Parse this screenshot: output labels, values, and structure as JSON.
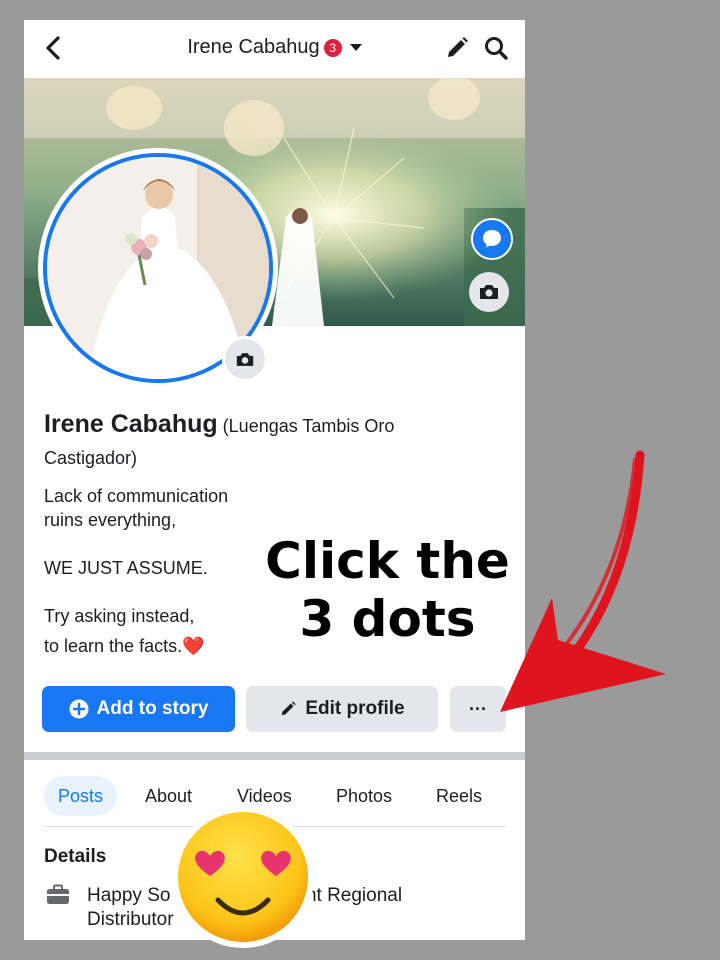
{
  "header": {
    "title": "Irene Cabahug",
    "notification_count": "3",
    "icons": [
      "back-arrow-icon",
      "chevron-down-icon",
      "pencil-icon",
      "search-icon"
    ]
  },
  "profile": {
    "name": "Irene Cabahug",
    "alt_name_line1": "(Luengas Tambis Oro",
    "alt_name_line2": "Castigador)",
    "bio": {
      "line1": "Lack of communication",
      "line2": "ruins everything,",
      "line3": "WE JUST ASSUME.",
      "line4": "Try asking instead,",
      "line5": "to learn the facts.",
      "emoji": "❤️"
    }
  },
  "actions": {
    "add_story": "Add to story",
    "edit_profile": "Edit profile",
    "more": "···"
  },
  "tabs": [
    "Posts",
    "About",
    "Videos",
    "Photos",
    "Reels"
  ],
  "details": {
    "heading": "Details",
    "work_line1": "Happy So",
    "work_line1_end": "tint Regional",
    "work_line2": "Distributor"
  },
  "overlay": {
    "line1": "Click the",
    "line2": "3 dots"
  },
  "colors": {
    "brand_blue": "#1877f2",
    "badge_red": "#e41e3f",
    "arrow_red": "#e0141e",
    "page_bg": "#9a9a9a"
  }
}
